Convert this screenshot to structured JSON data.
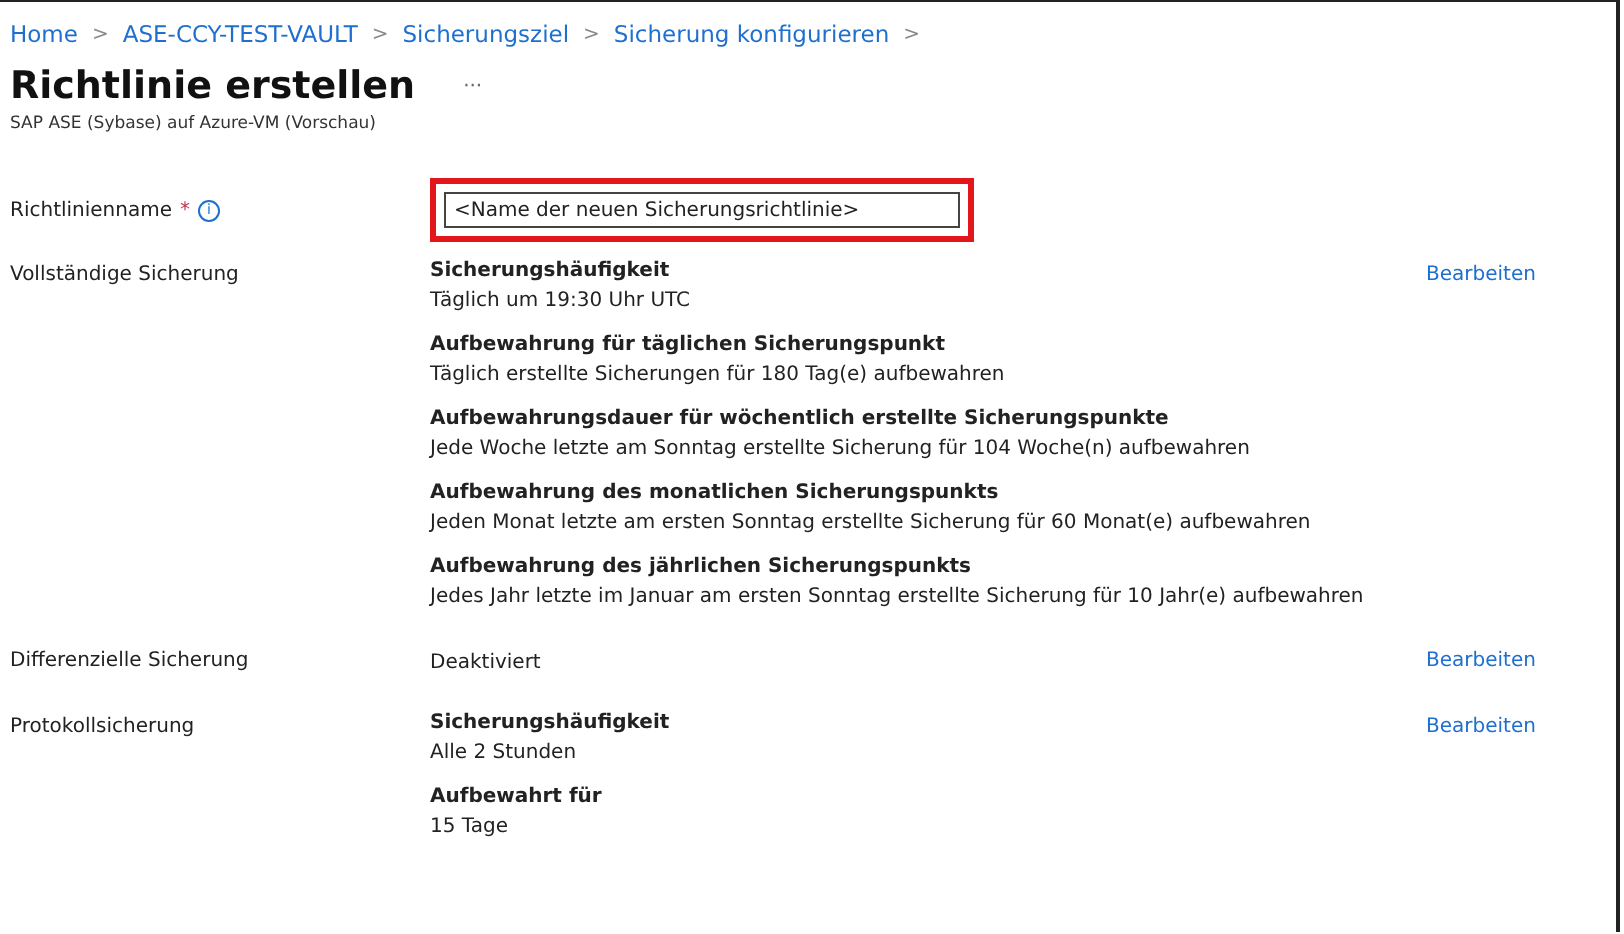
{
  "breadcrumb": [
    "Home",
    "ASE-CCY-TEST-VAULT",
    "Sicherungsziel",
    "Sicherung konfigurieren"
  ],
  "separator": ">",
  "title": "Richtlinie erstellen",
  "more": "···",
  "subtitle": "SAP ASE (Sybase) auf Azure-VM (Vorschau)",
  "name_field": {
    "label": "Richtlinienname",
    "required": "*",
    "info": "i",
    "value": "<Name der neuen Sicherungsrichtlinie>",
    "highlighted": true
  },
  "sections": [
    {
      "label": "Vollständige Sicherung",
      "edit": "Bearbeiten",
      "items": [
        {
          "heading": "Sicherungshäufigkeit",
          "text": "Täglich um 19:30 Uhr UTC"
        },
        {
          "heading": "Aufbewahrung für täglichen Sicherungspunkt",
          "text": "Täglich erstellte Sicherungen für 180 Tag(e) aufbewahren"
        },
        {
          "heading": "Aufbewahrungsdauer für wöchentlich erstellte Sicherungspunkte",
          "text": "Jede Woche letzte am Sonntag erstellte Sicherung für 104 Woche(n) aufbewahren"
        },
        {
          "heading": "Aufbewahrung des monatlichen Sicherungspunkts",
          "text": "Jeden Monat letzte am ersten Sonntag erstellte Sicherung für 60 Monat(e) aufbewahren"
        },
        {
          "heading": "Aufbewahrung des jährlichen Sicherungspunkts",
          "text": "Jedes Jahr letzte im Januar am ersten Sonntag erstellte Sicherung für 10 Jahr(e) aufbewahren"
        }
      ]
    },
    {
      "label": "Differenzielle Sicherung",
      "edit": "Bearbeiten",
      "items": [
        {
          "text": "Deaktiviert"
        }
      ]
    },
    {
      "label": "Protokollsicherung",
      "edit": "Bearbeiten",
      "items": [
        {
          "heading": "Sicherungshäufigkeit",
          "text": "Alle 2 Stunden"
        },
        {
          "heading": "Aufbewahrt für",
          "text": "15 Tage"
        }
      ]
    }
  ]
}
